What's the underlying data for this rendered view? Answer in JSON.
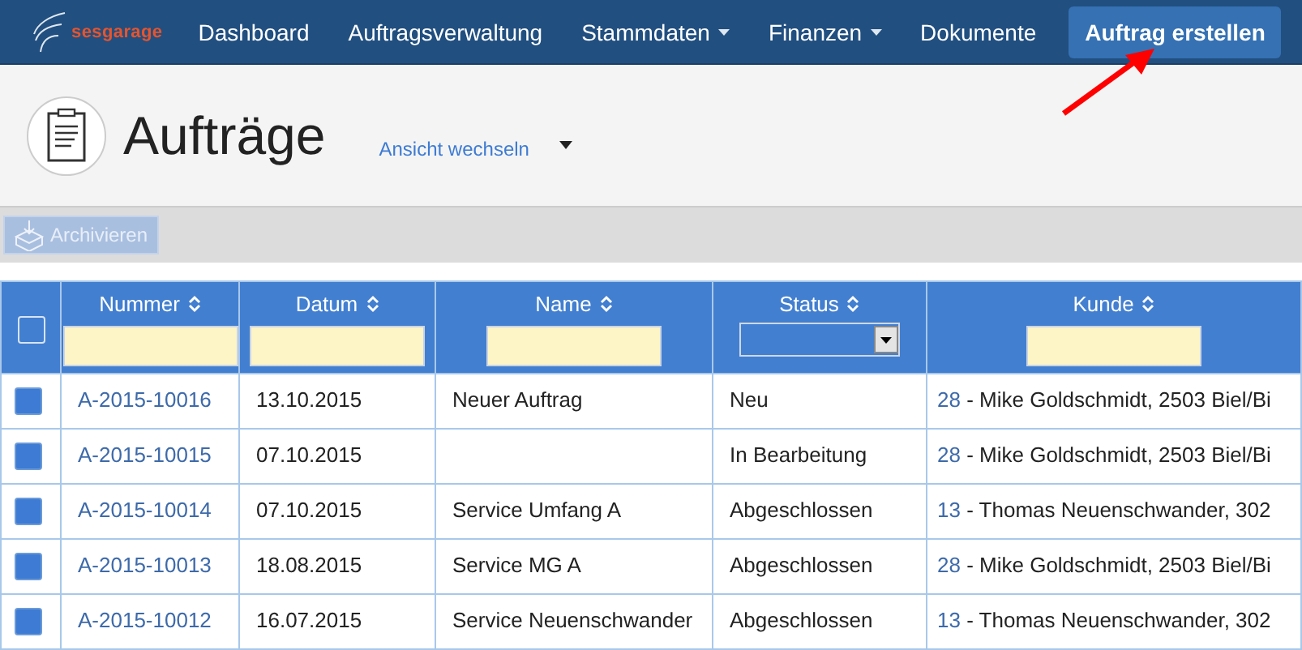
{
  "brand": "sesgarage",
  "nav": [
    {
      "label": "Dashboard",
      "dropdown": false
    },
    {
      "label": "Auftragsverwaltung",
      "dropdown": false
    },
    {
      "label": "Stammdaten",
      "dropdown": true
    },
    {
      "label": "Finanzen",
      "dropdown": true
    },
    {
      "label": "Dokumente",
      "dropdown": false
    }
  ],
  "primary_button": "Auftrag erstellen",
  "page_title": "Aufträge",
  "view_switch": "Ansicht wechseln",
  "toolbar": {
    "archive_button": "Archivieren",
    "disabled": true
  },
  "table": {
    "select_all": {
      "checked": false
    },
    "columns": [
      {
        "label": "Nummer",
        "kind": "text"
      },
      {
        "label": "Datum",
        "kind": "text"
      },
      {
        "label": "Name",
        "kind": "text"
      },
      {
        "label": "Status",
        "kind": "select"
      },
      {
        "label": "Kunde",
        "kind": "text"
      }
    ],
    "rows": [
      {
        "checked": true,
        "number": "A-2015-10016",
        "date": "13.10.2015",
        "name": "Neuer Auftrag",
        "status": "Neu",
        "customer_id": "28",
        "customer": " - Mike Goldschmidt, 2503 Biel/Bi"
      },
      {
        "checked": true,
        "number": "A-2015-10015",
        "date": "07.10.2015",
        "status": "In Bearbeitung",
        "customer_id": "28",
        "customer": " - Mike Goldschmidt, 2503 Biel/Bi"
      },
      {
        "checked": true,
        "number": "A-2015-10014",
        "date": "07.10.2015",
        "name": "Service Umfang A",
        "status": "Abgeschlossen",
        "customer_id": "13",
        "customer": " - Thomas Neuenschwander, 302"
      },
      {
        "checked": true,
        "number": "A-2015-10013",
        "date": "18.08.2015",
        "name": "Service MG A",
        "status": "Abgeschlossen",
        "customer_id": "28",
        "customer": " - Mike Goldschmidt, 2503 Biel/Bi"
      },
      {
        "checked": true,
        "number": "A-2015-10012",
        "date": "16.07.2015",
        "name": "Service Neuenschwander",
        "status": "Abgeschlossen",
        "customer_id": "13",
        "customer": " - Thomas Neuenschwander, 302"
      }
    ]
  }
}
